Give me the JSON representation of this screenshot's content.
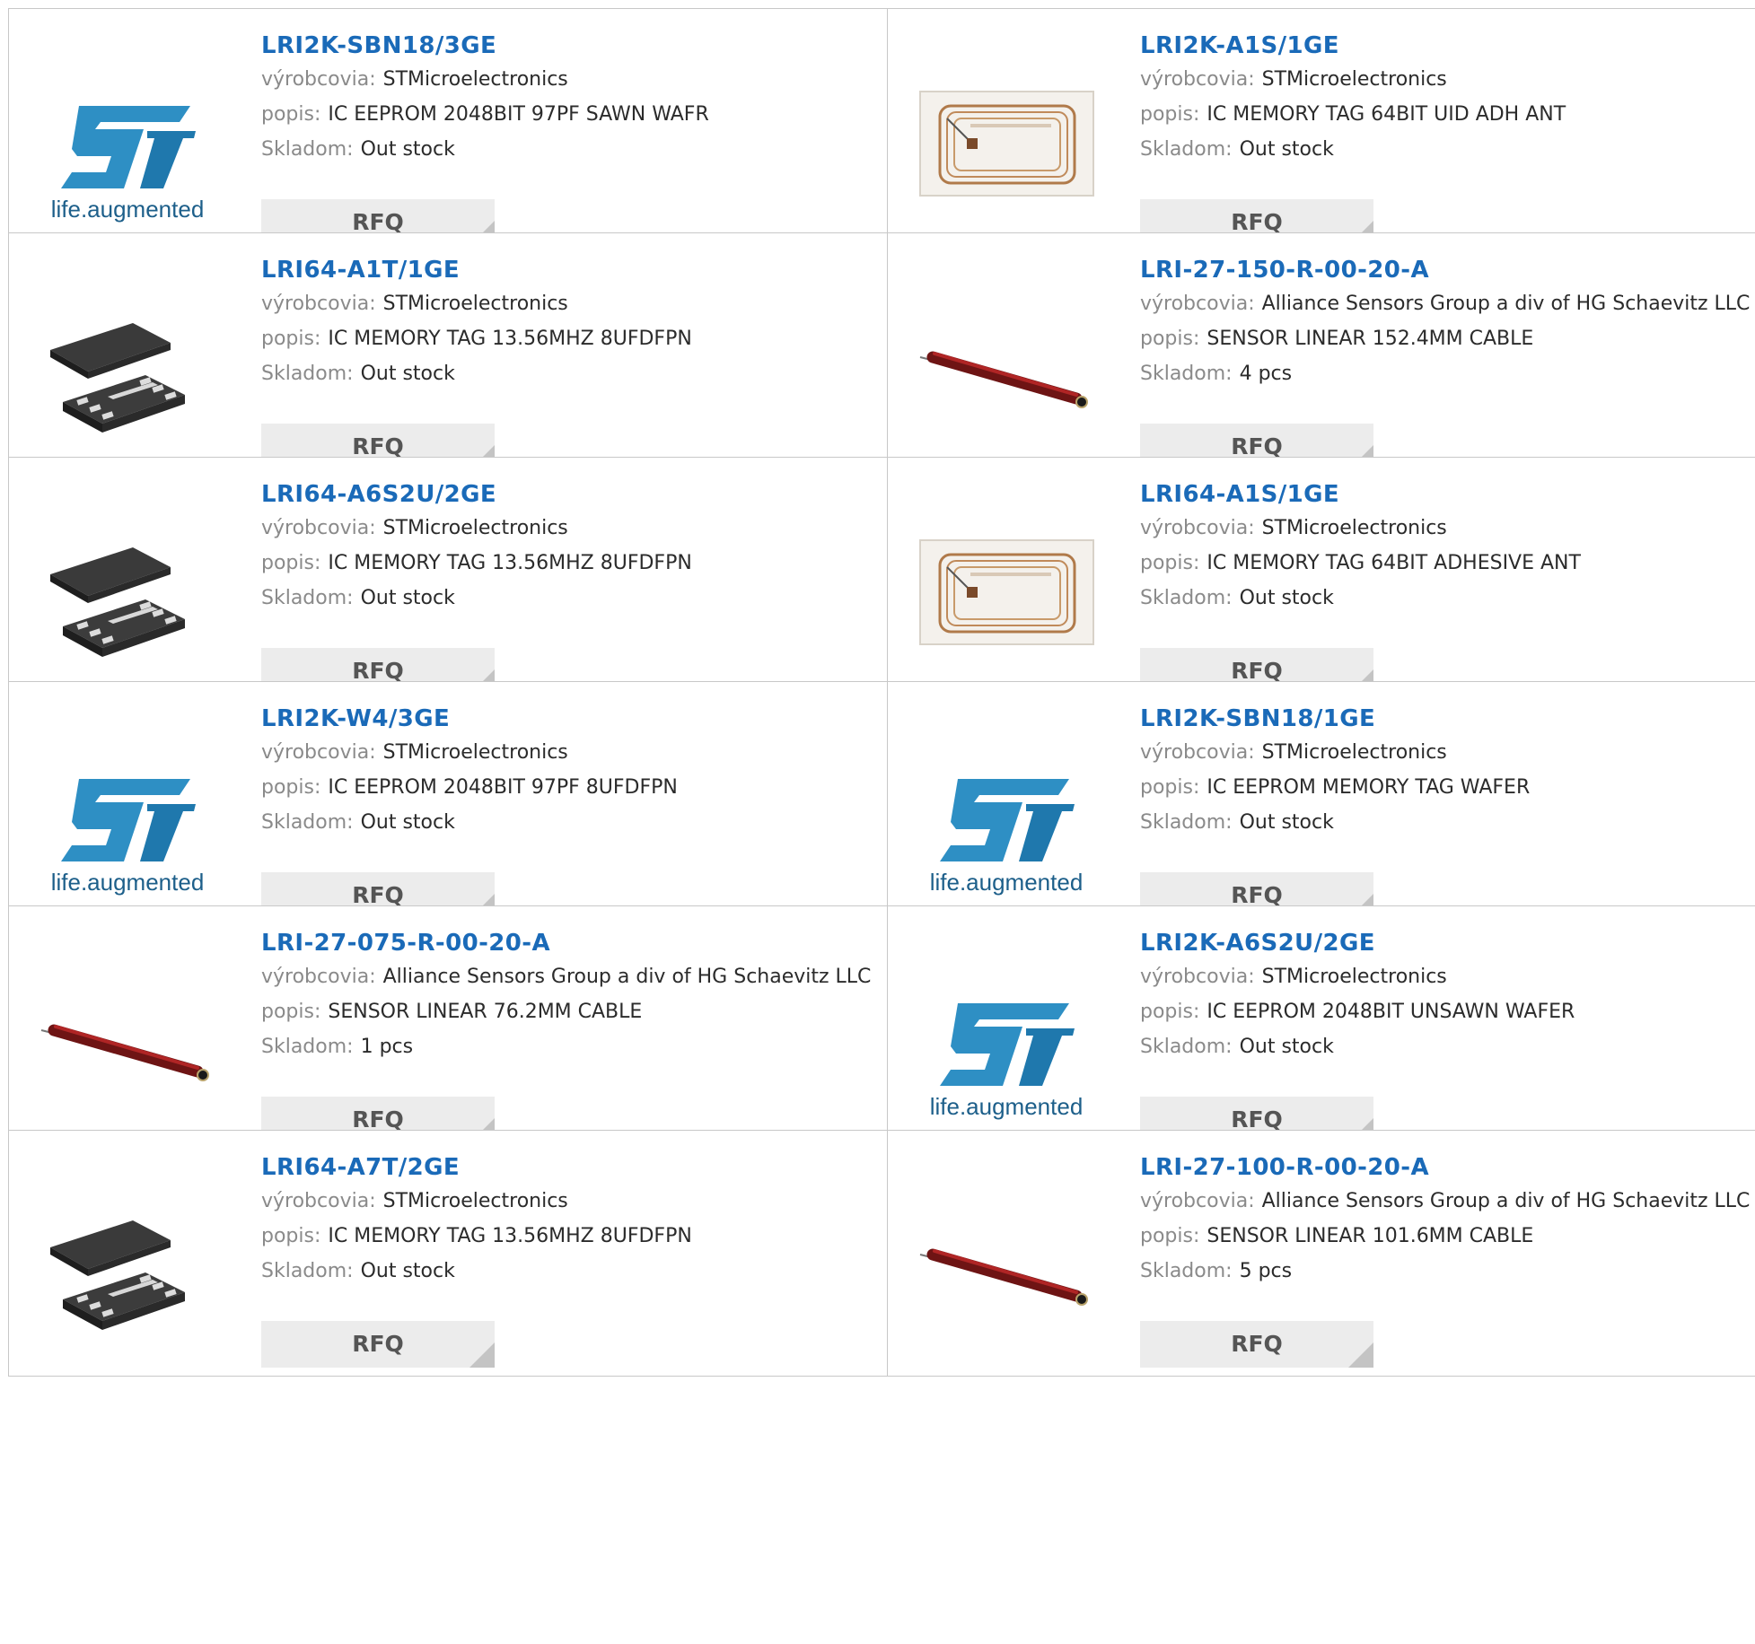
{
  "products": [
    {
      "part": "LRI2K-SBN18/3GE",
      "image": "st-logo",
      "mfr_label": "výrobcovia:",
      "manufacturer": "STMicroelectronics",
      "desc_label": "popis:",
      "description": "IC EEPROM 2048BIT 97PF SAWN WAFR",
      "stock_label": "Skladom:",
      "stock": "Out stock",
      "rfq": "RFQ"
    },
    {
      "part": "LRI2K-A1S/1GE",
      "image": "rfid-tag",
      "mfr_label": "výrobcovia:",
      "manufacturer": "STMicroelectronics",
      "desc_label": "popis:",
      "description": "IC MEMORY TAG 64BIT UID ADH ANT",
      "stock_label": "Skladom:",
      "stock": "Out stock",
      "rfq": "RFQ"
    },
    {
      "part": "LRI64-A1T/1GE",
      "image": "chip-package",
      "mfr_label": "výrobcovia:",
      "manufacturer": "STMicroelectronics",
      "desc_label": "popis:",
      "description": "IC MEMORY TAG 13.56MHZ 8UFDFPN",
      "stock_label": "Skladom:",
      "stock": "Out stock",
      "rfq": "RFQ"
    },
    {
      "part": "LRI-27-150-R-00-20-A",
      "image": "linear-sensor",
      "mfr_label": "výrobcovia:",
      "manufacturer": "Alliance Sensors Group a div of HG Schaevitz LLC",
      "desc_label": "popis:",
      "description": "SENSOR LINEAR 152.4MM CABLE",
      "stock_label": "Skladom:",
      "stock": "4 pcs",
      "rfq": "RFQ"
    },
    {
      "part": "LRI64-A6S2U/2GE",
      "image": "chip-package",
      "mfr_label": "výrobcovia:",
      "manufacturer": "STMicroelectronics",
      "desc_label": "popis:",
      "description": "IC MEMORY TAG 13.56MHZ 8UFDFPN",
      "stock_label": "Skladom:",
      "stock": "Out stock",
      "rfq": "RFQ"
    },
    {
      "part": "LRI64-A1S/1GE",
      "image": "rfid-tag",
      "mfr_label": "výrobcovia:",
      "manufacturer": "STMicroelectronics",
      "desc_label": "popis:",
      "description": "IC MEMORY TAG 64BIT ADHESIVE ANT",
      "stock_label": "Skladom:",
      "stock": "Out stock",
      "rfq": "RFQ"
    },
    {
      "part": "LRI2K-W4/3GE",
      "image": "st-logo",
      "mfr_label": "výrobcovia:",
      "manufacturer": "STMicroelectronics",
      "desc_label": "popis:",
      "description": "IC EEPROM 2048BIT 97PF 8UFDFPN",
      "stock_label": "Skladom:",
      "stock": "Out stock",
      "rfq": "RFQ"
    },
    {
      "part": "LRI2K-SBN18/1GE",
      "image": "st-logo",
      "mfr_label": "výrobcovia:",
      "manufacturer": "STMicroelectronics",
      "desc_label": "popis:",
      "description": "IC EEPROM MEMORY TAG WAFER",
      "stock_label": "Skladom:",
      "stock": "Out stock",
      "rfq": "RFQ"
    },
    {
      "part": "LRI-27-075-R-00-20-A",
      "image": "linear-sensor",
      "mfr_label": "výrobcovia:",
      "manufacturer": "Alliance Sensors Group a div of HG Schaevitz LLC",
      "desc_label": "popis:",
      "description": "SENSOR LINEAR 76.2MM CABLE",
      "stock_label": "Skladom:",
      "stock": "1 pcs",
      "rfq": "RFQ"
    },
    {
      "part": "LRI2K-A6S2U/2GE",
      "image": "st-logo",
      "mfr_label": "výrobcovia:",
      "manufacturer": "STMicroelectronics",
      "desc_label": "popis:",
      "description": "IC EEPROM 2048BIT UNSAWN WAFER",
      "stock_label": "Skladom:",
      "stock": "Out stock",
      "rfq": "RFQ"
    },
    {
      "part": "LRI64-A7T/2GE",
      "image": "chip-package",
      "mfr_label": "výrobcovia:",
      "manufacturer": "STMicroelectronics",
      "desc_label": "popis:",
      "description": "IC MEMORY TAG 13.56MHZ 8UFDFPN",
      "stock_label": "Skladom:",
      "stock": "Out stock",
      "rfq": "RFQ"
    },
    {
      "part": "LRI-27-100-R-00-20-A",
      "image": "linear-sensor",
      "mfr_label": "výrobcovia:",
      "manufacturer": "Alliance Sensors Group a div of HG Schaevitz LLC",
      "desc_label": "popis:",
      "description": "SENSOR LINEAR 101.6MM CABLE",
      "stock_label": "Skladom:",
      "stock": "5 pcs",
      "rfq": "RFQ"
    }
  ],
  "st_logo_text": "life.augmented",
  "colors": {
    "link": "#1a6ab8",
    "st_blue": "#2e8fc4",
    "border": "#c8c8c8",
    "rfq_bg": "#ececec"
  }
}
